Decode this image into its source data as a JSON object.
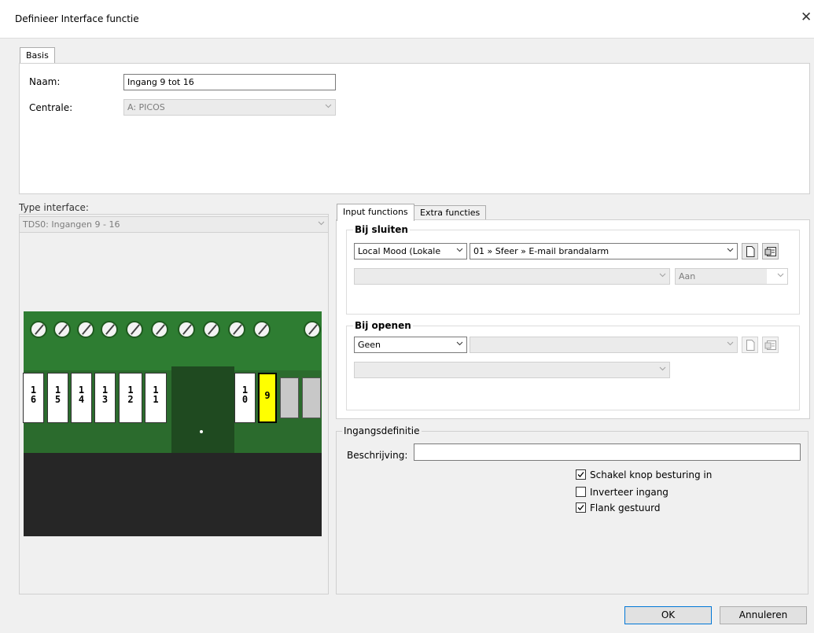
{
  "window": {
    "title": "Definieer Interface functie",
    "close_label": "✕"
  },
  "basis": {
    "tab_label": "Basis",
    "naam_label": "Naam:",
    "naam_value": "Ingang 9 tot 16",
    "centrale_label": "Centrale:",
    "centrale_value": "A: PICOS"
  },
  "type_interface": {
    "label": "Type interface:",
    "value": "TDS0: Ingangen 9 - 16"
  },
  "terminals": {
    "labels": [
      "1\n6",
      "1\n5",
      "1\n4",
      "1\n3",
      "1\n2",
      "1\n1",
      "1\n0",
      "9"
    ],
    "selected": "9",
    "highlight_color": "#ffff00"
  },
  "tabs": {
    "input_functions": "Input functions",
    "extra_functies": "Extra functies"
  },
  "bij_sluiten": {
    "title": "Bij sluiten",
    "type_value": "Local Mood (Lokale",
    "action_value": "01  » Sfeer » E-mail brandalarm",
    "sub_value": "",
    "state_value": "Aan"
  },
  "bij_openen": {
    "title": "Bij openen",
    "type_value": "Geen",
    "action_value": "",
    "sub_value": ""
  },
  "ingangsdefinitie": {
    "title": "Ingangsdefinitie",
    "beschrijving_label": "Beschrijving:",
    "beschrijving_value": "",
    "checkboxes": [
      {
        "label": "Schakel knop besturing in",
        "checked": true
      },
      {
        "label": "Inverteer ingang",
        "checked": false
      },
      {
        "label": "Flank gestuurd",
        "checked": true
      }
    ]
  },
  "buttons": {
    "ok": "OK",
    "cancel": "Annuleren"
  }
}
